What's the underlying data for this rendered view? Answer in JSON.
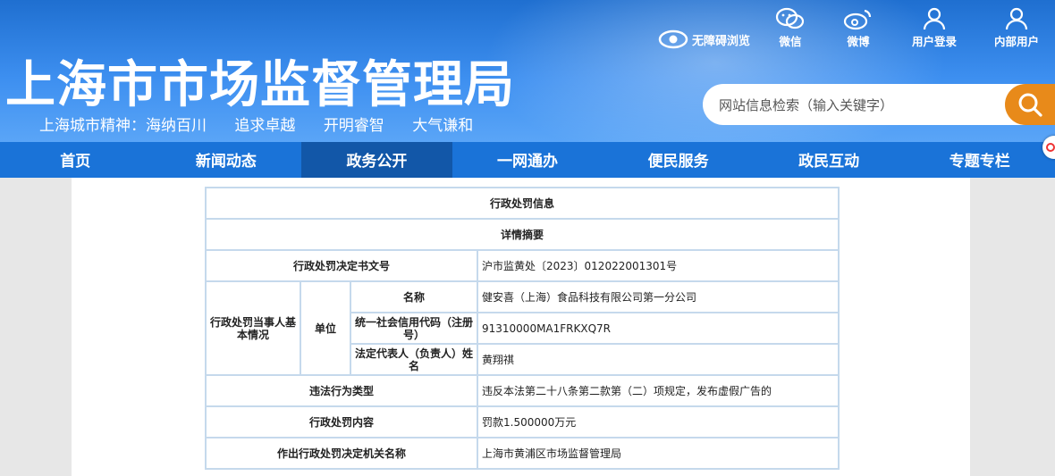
{
  "header": {
    "site_title": "上海市市场监督管理局",
    "slogan": [
      "上海城市精神：海纳百川",
      "追求卓越",
      "开明睿智",
      "大气谦和"
    ],
    "accessibility_label": "无障碍浏览",
    "top_links": [
      {
        "label": "微信",
        "icon": "wechat-icon"
      },
      {
        "label": "微博",
        "icon": "weibo-icon"
      },
      {
        "label": "用户登录",
        "icon": "user-icon"
      },
      {
        "label": "内部用户",
        "icon": "user-icon"
      }
    ],
    "search_placeholder": "网站信息检索（输入关键字）"
  },
  "nav": {
    "items": [
      "首页",
      "新闻动态",
      "政务公开",
      "一网通办",
      "便民服务",
      "政民互动",
      "专题专栏"
    ],
    "active": "政务公开"
  },
  "detail": {
    "title": "行政处罚信息",
    "subtitle": "详情摘要",
    "doc_no_label": "行政处罚决定书文号",
    "doc_no": "沪市监黄处〔2023〕012022001301号",
    "party_label": "行政处罚当事人基本情况",
    "unit_label": "单位",
    "name_label": "名称",
    "name": "健安喜（上海）食品科技有限公司第一分公司",
    "credit_label": "统一社会信用代码（注册号）",
    "credit": "91310000MA1FRKXQ7R",
    "rep_label": "法定代表人（负责人）姓名",
    "rep": "黄翔祺",
    "violation_label": "违法行为类型",
    "violation": "违反本法第二十八条第二款第（二）项规定，发布虚假广告的",
    "content_label": "行政处罚内容",
    "content": "罚款1.500000万元",
    "authority_label": "作出行政处罚决定机关名称",
    "authority": "上海市黄浦区市场监督管理局"
  },
  "colors": {
    "header_blue": "#2f80e0",
    "nav_blue": "#1a73d8",
    "nav_active": "#1257a8",
    "search_button": "#e88a1a",
    "table_border": "#c5d9ec"
  }
}
